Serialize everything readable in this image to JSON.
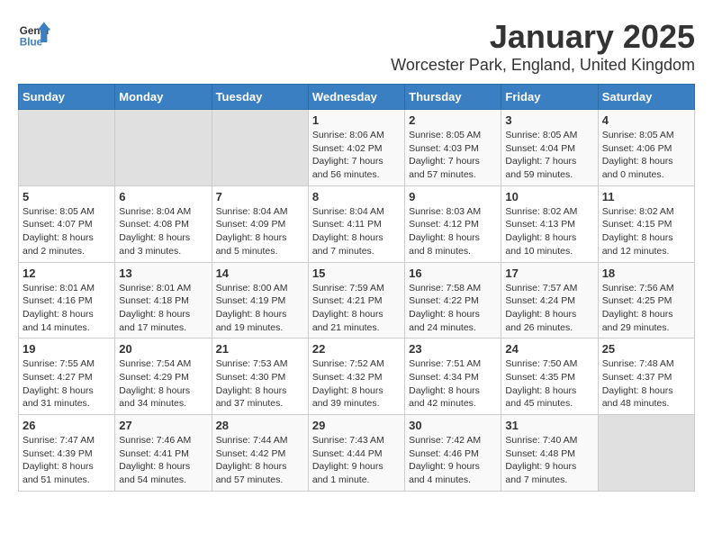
{
  "logo": {
    "general": "General",
    "blue": "Blue"
  },
  "title": "January 2025",
  "subtitle": "Worcester Park, England, United Kingdom",
  "days_of_week": [
    "Sunday",
    "Monday",
    "Tuesday",
    "Wednesday",
    "Thursday",
    "Friday",
    "Saturday"
  ],
  "weeks": [
    {
      "days": [
        {
          "number": "",
          "info": "",
          "empty": true
        },
        {
          "number": "",
          "info": "",
          "empty": true
        },
        {
          "number": "",
          "info": "",
          "empty": true
        },
        {
          "number": "1",
          "info": "Sunrise: 8:06 AM\nSunset: 4:02 PM\nDaylight: 7 hours and 56 minutes.",
          "empty": false
        },
        {
          "number": "2",
          "info": "Sunrise: 8:05 AM\nSunset: 4:03 PM\nDaylight: 7 hours and 57 minutes.",
          "empty": false
        },
        {
          "number": "3",
          "info": "Sunrise: 8:05 AM\nSunset: 4:04 PM\nDaylight: 7 hours and 59 minutes.",
          "empty": false
        },
        {
          "number": "4",
          "info": "Sunrise: 8:05 AM\nSunset: 4:06 PM\nDaylight: 8 hours and 0 minutes.",
          "empty": false
        }
      ]
    },
    {
      "days": [
        {
          "number": "5",
          "info": "Sunrise: 8:05 AM\nSunset: 4:07 PM\nDaylight: 8 hours and 2 minutes.",
          "empty": false
        },
        {
          "number": "6",
          "info": "Sunrise: 8:04 AM\nSunset: 4:08 PM\nDaylight: 8 hours and 3 minutes.",
          "empty": false
        },
        {
          "number": "7",
          "info": "Sunrise: 8:04 AM\nSunset: 4:09 PM\nDaylight: 8 hours and 5 minutes.",
          "empty": false
        },
        {
          "number": "8",
          "info": "Sunrise: 8:04 AM\nSunset: 4:11 PM\nDaylight: 8 hours and 7 minutes.",
          "empty": false
        },
        {
          "number": "9",
          "info": "Sunrise: 8:03 AM\nSunset: 4:12 PM\nDaylight: 8 hours and 8 minutes.",
          "empty": false
        },
        {
          "number": "10",
          "info": "Sunrise: 8:02 AM\nSunset: 4:13 PM\nDaylight: 8 hours and 10 minutes.",
          "empty": false
        },
        {
          "number": "11",
          "info": "Sunrise: 8:02 AM\nSunset: 4:15 PM\nDaylight: 8 hours and 12 minutes.",
          "empty": false
        }
      ]
    },
    {
      "days": [
        {
          "number": "12",
          "info": "Sunrise: 8:01 AM\nSunset: 4:16 PM\nDaylight: 8 hours and 14 minutes.",
          "empty": false
        },
        {
          "number": "13",
          "info": "Sunrise: 8:01 AM\nSunset: 4:18 PM\nDaylight: 8 hours and 17 minutes.",
          "empty": false
        },
        {
          "number": "14",
          "info": "Sunrise: 8:00 AM\nSunset: 4:19 PM\nDaylight: 8 hours and 19 minutes.",
          "empty": false
        },
        {
          "number": "15",
          "info": "Sunrise: 7:59 AM\nSunset: 4:21 PM\nDaylight: 8 hours and 21 minutes.",
          "empty": false
        },
        {
          "number": "16",
          "info": "Sunrise: 7:58 AM\nSunset: 4:22 PM\nDaylight: 8 hours and 24 minutes.",
          "empty": false
        },
        {
          "number": "17",
          "info": "Sunrise: 7:57 AM\nSunset: 4:24 PM\nDaylight: 8 hours and 26 minutes.",
          "empty": false
        },
        {
          "number": "18",
          "info": "Sunrise: 7:56 AM\nSunset: 4:25 PM\nDaylight: 8 hours and 29 minutes.",
          "empty": false
        }
      ]
    },
    {
      "days": [
        {
          "number": "19",
          "info": "Sunrise: 7:55 AM\nSunset: 4:27 PM\nDaylight: 8 hours and 31 minutes.",
          "empty": false
        },
        {
          "number": "20",
          "info": "Sunrise: 7:54 AM\nSunset: 4:29 PM\nDaylight: 8 hours and 34 minutes.",
          "empty": false
        },
        {
          "number": "21",
          "info": "Sunrise: 7:53 AM\nSunset: 4:30 PM\nDaylight: 8 hours and 37 minutes.",
          "empty": false
        },
        {
          "number": "22",
          "info": "Sunrise: 7:52 AM\nSunset: 4:32 PM\nDaylight: 8 hours and 39 minutes.",
          "empty": false
        },
        {
          "number": "23",
          "info": "Sunrise: 7:51 AM\nSunset: 4:34 PM\nDaylight: 8 hours and 42 minutes.",
          "empty": false
        },
        {
          "number": "24",
          "info": "Sunrise: 7:50 AM\nSunset: 4:35 PM\nDaylight: 8 hours and 45 minutes.",
          "empty": false
        },
        {
          "number": "25",
          "info": "Sunrise: 7:48 AM\nSunset: 4:37 PM\nDaylight: 8 hours and 48 minutes.",
          "empty": false
        }
      ]
    },
    {
      "days": [
        {
          "number": "26",
          "info": "Sunrise: 7:47 AM\nSunset: 4:39 PM\nDaylight: 8 hours and 51 minutes.",
          "empty": false
        },
        {
          "number": "27",
          "info": "Sunrise: 7:46 AM\nSunset: 4:41 PM\nDaylight: 8 hours and 54 minutes.",
          "empty": false
        },
        {
          "number": "28",
          "info": "Sunrise: 7:44 AM\nSunset: 4:42 PM\nDaylight: 8 hours and 57 minutes.",
          "empty": false
        },
        {
          "number": "29",
          "info": "Sunrise: 7:43 AM\nSunset: 4:44 PM\nDaylight: 9 hours and 1 minute.",
          "empty": false
        },
        {
          "number": "30",
          "info": "Sunrise: 7:42 AM\nSunset: 4:46 PM\nDaylight: 9 hours and 4 minutes.",
          "empty": false
        },
        {
          "number": "31",
          "info": "Sunrise: 7:40 AM\nSunset: 4:48 PM\nDaylight: 9 hours and 7 minutes.",
          "empty": false
        },
        {
          "number": "",
          "info": "",
          "empty": true
        }
      ]
    }
  ]
}
